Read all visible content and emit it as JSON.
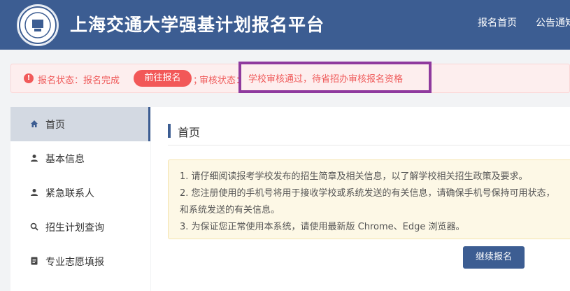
{
  "header": {
    "title": "上海交通大学强基计划报名平台",
    "nav": [
      "报名首页",
      "公告通知"
    ]
  },
  "status": {
    "label": "报名状态：报名完成",
    "button": "前往报名",
    "separator": "；",
    "review_label": "审核状态：",
    "review_value": "学校审核通过，待省招办审核报名资格",
    "color": "#ef5a5a"
  },
  "sidebar": {
    "items": [
      {
        "label": "首页",
        "icon": "home-icon"
      },
      {
        "label": "基本信息",
        "icon": "user-icon"
      },
      {
        "label": "紧急联系人",
        "icon": "user-icon"
      },
      {
        "label": "招生计划查询",
        "icon": "search-icon"
      },
      {
        "label": "专业志愿填报",
        "icon": "document-icon"
      }
    ]
  },
  "main": {
    "title": "首页",
    "notice": [
      "1. 请仔细阅读报考学校发布的招生简章及相关信息，以了解学校相关招生政策及要求。",
      "2. 您注册使用的手机号将用于接收学校或系统发送的有关信息，请确保手机号保持可用状态，",
      "和系统发送的有关信息。",
      "3. 为保证您正常使用本系统，请使用最新版 Chrome、Edge 浏览器。"
    ],
    "continue_button": "继续报名"
  },
  "colors": {
    "brand": "#3c5d92",
    "alert": "#f25858",
    "highlight": "#8f3a9e"
  }
}
